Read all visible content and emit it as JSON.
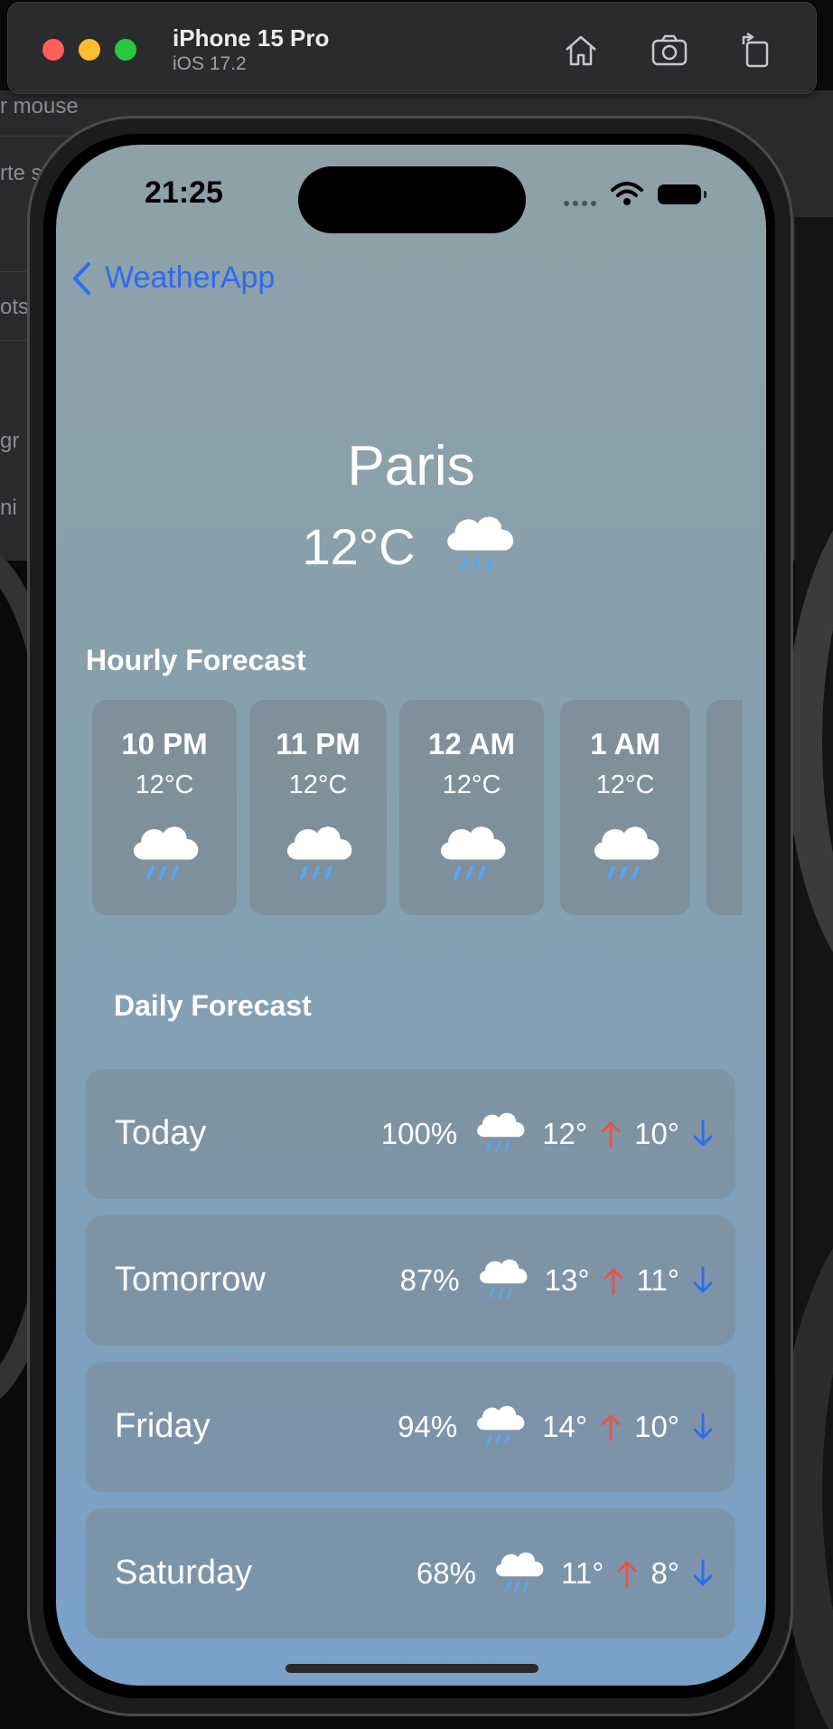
{
  "simulator": {
    "device_name": "iPhone 15 Pro",
    "os_version": "iOS 17.2",
    "toolbar_icons": [
      "home-icon",
      "screenshot-icon",
      "rotate-icon"
    ]
  },
  "background_window": {
    "fragments": [
      "r mouse",
      "rte s",
      "ots",
      "gr",
      "ni"
    ]
  },
  "status_bar": {
    "time": "21:25"
  },
  "nav": {
    "back_label": "WeatherApp"
  },
  "current": {
    "city": "Paris",
    "temperature": "12°C",
    "icon": "cloud-rain-icon"
  },
  "hourly": {
    "title": "Hourly Forecast",
    "items": [
      {
        "time": "10 PM",
        "temp": "12°C",
        "icon": "cloud-rain-icon"
      },
      {
        "time": "11 PM",
        "temp": "12°C",
        "icon": "cloud-rain-icon"
      },
      {
        "time": "12 AM",
        "temp": "12°C",
        "icon": "cloud-rain-icon"
      },
      {
        "time": "1 AM",
        "temp": "12°C",
        "icon": "cloud-rain-icon"
      }
    ]
  },
  "daily": {
    "title": "Daily Forecast",
    "items": [
      {
        "day": "Today",
        "precip": "100%",
        "high": "12°",
        "low": "10°",
        "icon": "cloud-rain-icon"
      },
      {
        "day": "Tomorrow",
        "precip": "87%",
        "high": "13°",
        "low": "11°",
        "icon": "cloud-rain-icon"
      },
      {
        "day": "Friday",
        "precip": "94%",
        "high": "14°",
        "low": "10°",
        "icon": "cloud-rain-icon"
      },
      {
        "day": "Saturday",
        "precip": "68%",
        "high": "11°",
        "low": "8°",
        "icon": "cloud-rain-icon"
      }
    ]
  },
  "colors": {
    "accent_blue": "#2f6bf0",
    "arrow_up": "#e0584a",
    "arrow_down": "#2f6bf0",
    "rain_drops": "#5aa7f0"
  }
}
